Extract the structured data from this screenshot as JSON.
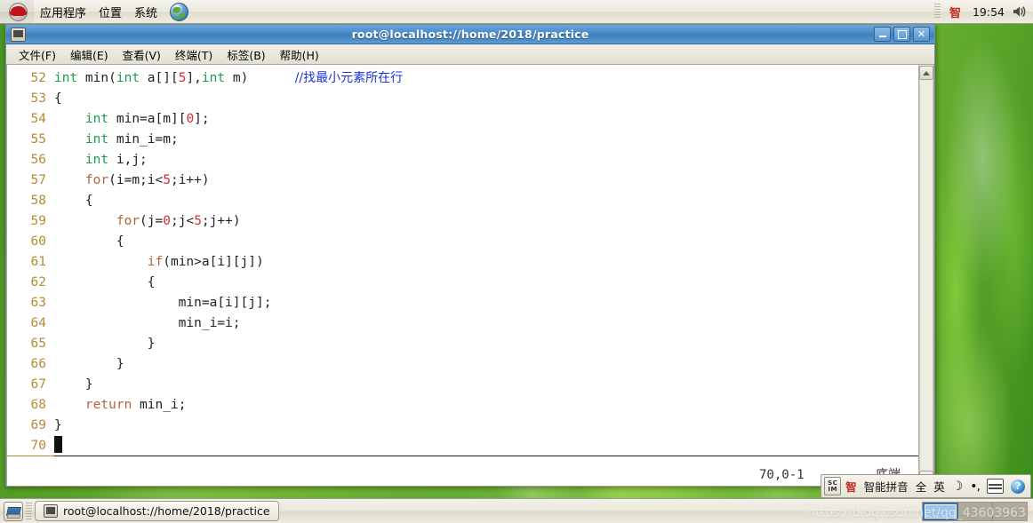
{
  "top_panel": {
    "logo_icon": "redhat-logo-icon",
    "menus": [
      {
        "label": "应用程序",
        "name": "applications"
      },
      {
        "label": "位置",
        "name": "places"
      },
      {
        "label": "系统",
        "name": "system"
      }
    ],
    "globe_icon": "globe-browser-icon",
    "tray": {
      "ime_indicator": "智",
      "clock": "19:54",
      "volume_icon": "speaker-icon"
    }
  },
  "terminal": {
    "title": "root@localhost://home/2018/practice",
    "window_icon": "terminal-icon",
    "window_buttons": {
      "minimize": "minimize-button",
      "maximize": "maximize-button",
      "close": "close-button"
    },
    "menu": [
      {
        "label": "文件(F)",
        "name": "file"
      },
      {
        "label": "编辑(E)",
        "name": "edit"
      },
      {
        "label": "查看(V)",
        "name": "view"
      },
      {
        "label": "终端(T)",
        "name": "terminal"
      },
      {
        "label": "标签(B)",
        "name": "tabs"
      },
      {
        "label": "帮助(H)",
        "name": "help"
      }
    ],
    "editor": {
      "lines": [
        {
          "num": "52",
          "html": "<span class=\"k-type\">int</span> min(<span class=\"k-type\">int</span> a[][<span class=\"k-num\">5</span>],<span class=\"k-type\">int</span> m)      <span class=\"k-cmt\">//找最小元素所在行</span>"
        },
        {
          "num": "53",
          "html": "{"
        },
        {
          "num": "54",
          "html": "    <span class=\"k-type\">int</span> min=a[m][<span class=\"k-num\">0</span>];"
        },
        {
          "num": "55",
          "html": "    <span class=\"k-type\">int</span> min_i=m;"
        },
        {
          "num": "56",
          "html": "    <span class=\"k-type\">int</span> i,j;"
        },
        {
          "num": "57",
          "html": "    <span class=\"k-stmt\">for</span>(i=m;i&lt;<span class=\"k-num\">5</span>;i++)"
        },
        {
          "num": "58",
          "html": "    {"
        },
        {
          "num": "59",
          "html": "        <span class=\"k-stmt\">for</span>(j=<span class=\"k-num\">0</span>;j&lt;<span class=\"k-num\">5</span>;j++)"
        },
        {
          "num": "60",
          "html": "        {"
        },
        {
          "num": "61",
          "html": "            <span class=\"k-stmt\">if</span>(min&gt;a[i][j])"
        },
        {
          "num": "62",
          "html": "            {"
        },
        {
          "num": "63",
          "html": "                min=a[i][j];"
        },
        {
          "num": "64",
          "html": "                min_i=i;"
        },
        {
          "num": "65",
          "html": "            }"
        },
        {
          "num": "66",
          "html": "        }"
        },
        {
          "num": "67",
          "html": "    }"
        },
        {
          "num": "68",
          "html": "    <span class=\"k-stmt\">return</span> min_i;"
        },
        {
          "num": "69",
          "html": "}"
        },
        {
          "num": "70",
          "html": "<span class=\"cursor\"></span>",
          "cursorline": true
        }
      ],
      "plain_lines": [
        "int min(int a[][5],int m)      //找最小元素所在行",
        "{",
        "    int min=a[m][0];",
        "    int min_i=m;",
        "    int i,j;",
        "    for(i=m;i<5;i++)",
        "    {",
        "        for(j=0;j<5;j++)",
        "        {",
        "            if(min>a[i][j])",
        "            {",
        "                min=a[i][j];",
        "                min_i=i;",
        "            }",
        "        }",
        "    }",
        "    return min_i;",
        "}",
        ""
      ],
      "status": {
        "ruler": "70,0-1",
        "position": "底端"
      }
    },
    "scrollbar": {
      "up_icon": "scroll-up-icon",
      "down_icon": "scroll-down-icon"
    }
  },
  "scim": {
    "panel_icon": "scim-icon",
    "panel_icon_text_top": "SC",
    "panel_icon_text_bottom": "IM",
    "items": [
      {
        "label": "智",
        "name": "ime-logo"
      },
      {
        "label": "智能拼音",
        "name": "ime-name"
      },
      {
        "label": "全",
        "name": "full-width-toggle"
      },
      {
        "label": "英",
        "name": "english-chinese-toggle"
      },
      {
        "label": "☽",
        "name": "moon-toggle"
      },
      {
        "label": "•,",
        "name": "punctuation-toggle"
      }
    ],
    "keyboard_icon": "keyboard-icon",
    "help_icon": "help-icon",
    "help_glyph": "?"
  },
  "bottom_panel": {
    "show_desktop_icon": "show-desktop-icon",
    "task_button": {
      "label": "root@localhost://home/2018/practice",
      "icon": "terminal-icon"
    },
    "workspaces": [
      {
        "name": "workspace-1",
        "active": true
      },
      {
        "name": "workspace-2",
        "active": false
      },
      {
        "name": "workspace-3",
        "active": false
      }
    ]
  },
  "watermark": "https://blog.csdn.net/qq_43603963"
}
